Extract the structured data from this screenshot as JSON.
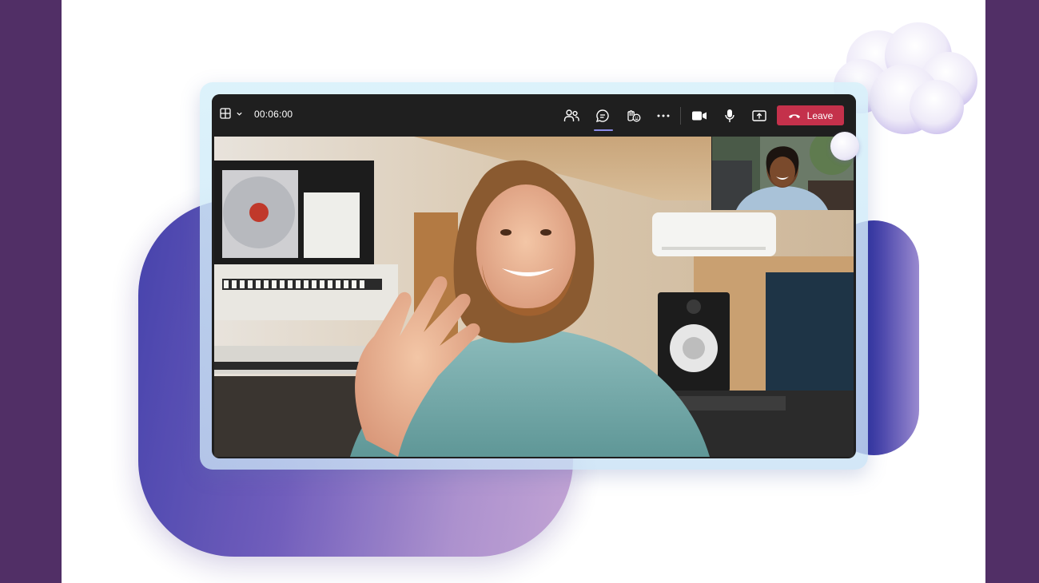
{
  "toolbar": {
    "timer": "00:06:00",
    "leave_label": "Leave"
  },
  "icons": {
    "layout": "grid-layout-icon",
    "chevron": "chevron-down-icon",
    "people": "people-icon",
    "chat": "chat-icon",
    "reactions": "raise-hand-reaction-icon",
    "more": "more-options-icon",
    "camera": "camera-icon",
    "mic": "microphone-icon",
    "share": "share-screen-icon",
    "hangup": "hang-up-phone-icon"
  },
  "colors": {
    "leave": "#c4314b",
    "toolbar": "#1f1f1f",
    "active_indicator": "#8b8ce8",
    "background": "#512f66"
  }
}
